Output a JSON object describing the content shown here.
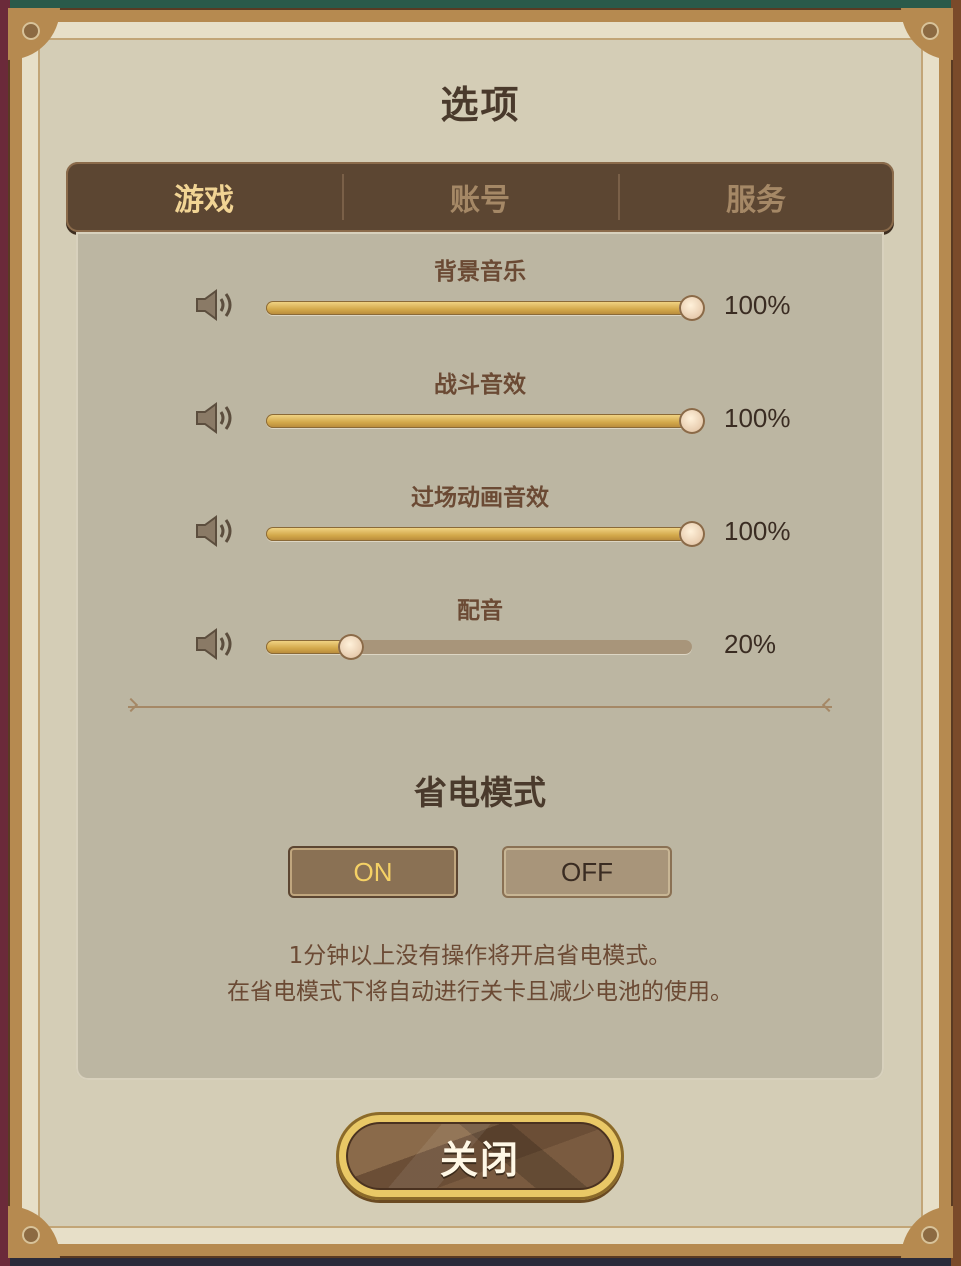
{
  "dialog": {
    "title": "选项"
  },
  "tabs": [
    {
      "label": "游戏",
      "active": true
    },
    {
      "label": "账号",
      "active": false
    },
    {
      "label": "服务",
      "active": false
    }
  ],
  "sliders": [
    {
      "label": "背景音乐",
      "value": 100,
      "display": "100%"
    },
    {
      "label": "战斗音效",
      "value": 100,
      "display": "100%"
    },
    {
      "label": "过场动画音效",
      "value": 100,
      "display": "100%"
    },
    {
      "label": "配音",
      "value": 20,
      "display": "20%"
    }
  ],
  "power_saving": {
    "title": "省电模式",
    "on_label": "ON",
    "off_label": "OFF",
    "selected": "ON",
    "description_line1": "1分钟以上没有操作将开启省电模式。",
    "description_line2": "在省电模式下将自动进行关卡且减少电池的使用。"
  },
  "close_button": {
    "label": "关闭"
  },
  "colors": {
    "frame": "#b68a50",
    "panel": "#bcb6a2",
    "tab_bar": "#5c4632",
    "active_tab_text": "#f1d494",
    "slider_fill": "#d3a84a",
    "on_text": "#f5d165"
  },
  "icons": {
    "volume": "speaker-icon"
  }
}
